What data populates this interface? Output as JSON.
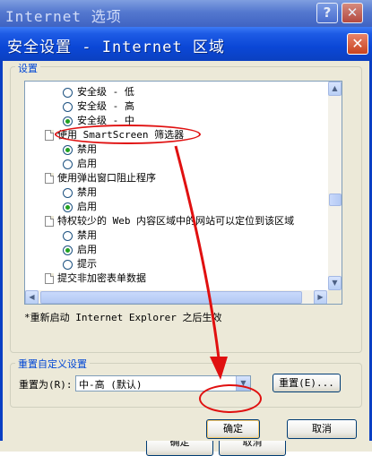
{
  "parent_window": {
    "title": "Internet 选项",
    "help_glyph": "?",
    "close_glyph": "✕",
    "bottom_buttons": [
      "确定",
      "取消"
    ]
  },
  "dialog": {
    "title": "安全设置 - Internet 区域",
    "close_glyph": "✕",
    "settings_group_label": "设置",
    "settings_list": [
      {
        "type": "option",
        "text": "安全级 - 低",
        "checked": false
      },
      {
        "type": "option",
        "text": "安全级 - 高",
        "checked": false
      },
      {
        "type": "option",
        "text": "安全级 - 中",
        "checked": true
      },
      {
        "type": "header",
        "text": "使用 SmartScreen 筛选器"
      },
      {
        "type": "option",
        "text": "禁用",
        "checked": true
      },
      {
        "type": "option",
        "text": "启用",
        "checked": false
      },
      {
        "type": "header",
        "text": "使用弹出窗口阻止程序"
      },
      {
        "type": "option",
        "text": "禁用",
        "checked": false
      },
      {
        "type": "option",
        "text": "启用",
        "checked": true
      },
      {
        "type": "header",
        "text": "特权较少的 Web 内容区域中的网站可以定位到该区域"
      },
      {
        "type": "option",
        "text": "禁用",
        "checked": false
      },
      {
        "type": "option",
        "text": "启用",
        "checked": true
      },
      {
        "type": "option",
        "text": "提示",
        "checked": false
      },
      {
        "type": "header",
        "text": "提交非加密表单数据"
      }
    ],
    "restart_note": "*重新启动 Internet Explorer 之后生效",
    "reset_group_label": "重置自定义设置",
    "reset_to_label": "重置为(R):",
    "reset_to_value": "中-高 (默认)",
    "reset_button": "重置(E)...",
    "ok_button": "确定",
    "cancel_button": "取消"
  },
  "annotation_color": "#e01010"
}
